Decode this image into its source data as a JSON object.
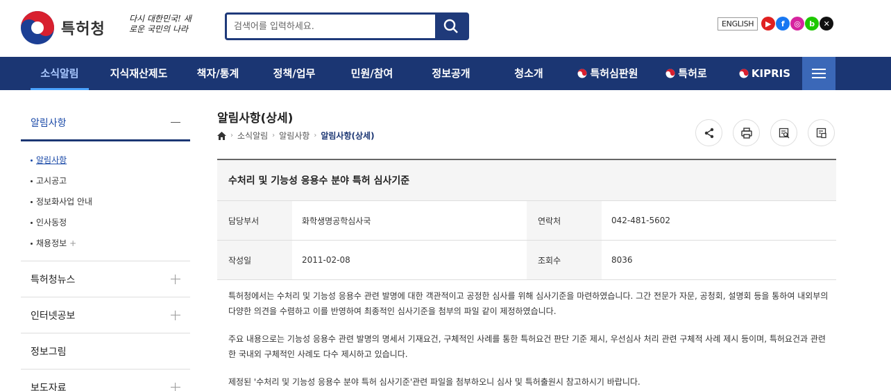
{
  "header": {
    "logo_text": "특허청",
    "slogan": "다시 대한민국! 새로운 국민의 나라",
    "search_placeholder": "검색어를 입력하세요.",
    "english_label": "ENGLISH",
    "sns": [
      {
        "name": "youtube-icon",
        "color": "#e02020",
        "glyph": "▶"
      },
      {
        "name": "facebook-icon",
        "color": "#1877f2",
        "glyph": "f"
      },
      {
        "name": "instagram-icon",
        "color": "#d6249f",
        "glyph": "◎"
      },
      {
        "name": "blog-icon",
        "color": "#1ec800",
        "glyph": "b"
      },
      {
        "name": "x-icon",
        "color": "#111111",
        "glyph": "✕"
      }
    ]
  },
  "nav": {
    "items": [
      "소식알림",
      "지식재산제도",
      "책자/통계",
      "정책/업무",
      "민원/참여",
      "정보공개",
      "청소개",
      "특허심판원",
      "특허로",
      "KIPRIS"
    ],
    "active_index": 0
  },
  "sidebar": {
    "top": "알림사항",
    "sub_items": [
      "알림사항",
      "고시공고",
      "정보화사업 안내",
      "인사동정",
      "채용정보"
    ],
    "active_sub": 0,
    "items": [
      {
        "label": "특허청뉴스",
        "expandable": true
      },
      {
        "label": "인터넷공보",
        "expandable": true
      },
      {
        "label": "정보그림",
        "expandable": false
      },
      {
        "label": "보도자료",
        "expandable": true
      }
    ]
  },
  "content": {
    "page_title": "알림사항(상세)",
    "breadcrumb": [
      "소식알림",
      "알림사항",
      "알림사항(상세)"
    ],
    "post": {
      "title": "수처리 및 기능성 응용수 분야 특허 심사기준",
      "dept_label": "담당부서",
      "dept_value": "화학생명공학심사국",
      "contact_label": "연락처",
      "contact_value": "042-481-5602",
      "date_label": "작성일",
      "date_value": "2011-02-08",
      "views_label": "조회수",
      "views_value": "8036"
    },
    "body": [
      "특허청에서는 수처리 및 기능성 응용수 관련 발명에 대한 객관적이고 공정한 심사를 위해 심사기준을 마련하였습니다. 그간 전문가 자문, 공청회, 설명회 등을 통하여 내외부의 다양한 의견을 수렴하고 이를 반영하여 최종적인 심사기준을 첨부의 파일 같이 제정하였습니다.",
      "주요 내용으로는 기능성 응용수 관련 발명의 명세서 기재요건, 구체적인 사례를 통한 특허요건 판단 기준 제시, 우선심사 처리 관련 구체적 사례 제시 등이며, 특허요건과 관련한 국내외 구체적인 사례도 다수 제시하고 있습니다.",
      "제정된 '수처리 및 기능성 응용수 분야 특허 심사기준'관련 파일을 첨부하오니 심사 및 특허출원시 참고하시기 바랍니다."
    ]
  }
}
